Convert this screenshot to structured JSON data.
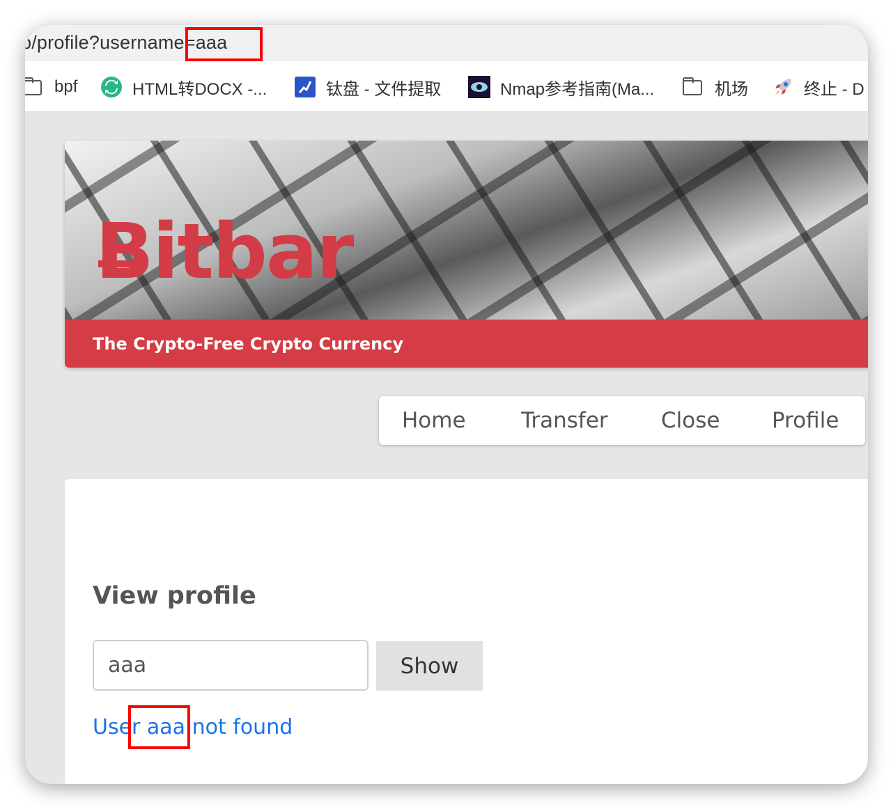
{
  "browser": {
    "url": "p/profile?username=aaa",
    "bookmarks": [
      {
        "icon": "folder-icon",
        "label": "bpf"
      },
      {
        "icon": "refresh-circle-icon",
        "label": "HTML转DOCX -..."
      },
      {
        "icon": "chain-link-icon",
        "label": "钛盘 - 文件提取"
      },
      {
        "icon": "eye-icon",
        "label": "Nmap参考指南(Ma..."
      },
      {
        "icon": "folder-icon",
        "label": "机场"
      },
      {
        "icon": "rocket-icon",
        "label": "终止 - D"
      }
    ]
  },
  "banner": {
    "logo": "Bitbar",
    "tagline": "The Crypto-Free Crypto Currency"
  },
  "nav": {
    "items": [
      "Home",
      "Transfer",
      "Close",
      "Profile"
    ]
  },
  "profile": {
    "title": "View profile",
    "input_value": "aaa",
    "show_label": "Show",
    "result": "User aaa not found"
  },
  "colors": {
    "brand": "#d43c46",
    "link": "#1a73e8",
    "highlight": "#ff0000"
  }
}
